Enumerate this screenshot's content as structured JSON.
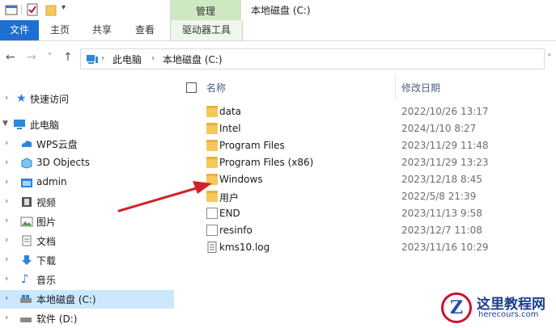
{
  "titlebar": {
    "manage_label": "管理",
    "title": "本地磁盘 (C:)"
  },
  "ribbon": {
    "tabs": [
      "文件",
      "主页",
      "共享",
      "查看",
      "驱动器工具"
    ]
  },
  "nav": {
    "path": [
      "此电脑",
      "本地磁盘 (C:)"
    ]
  },
  "sidebar": {
    "items": [
      {
        "label": "快速访问",
        "icon": "star-icon"
      },
      {
        "label": "此电脑",
        "icon": "computer-icon"
      },
      {
        "label": "WPS云盘",
        "icon": "cloud-icon"
      },
      {
        "label": "3D Objects",
        "icon": "cube-icon"
      },
      {
        "label": "admin",
        "icon": "folder-icon"
      },
      {
        "label": "视频",
        "icon": "video-icon"
      },
      {
        "label": "图片",
        "icon": "picture-icon"
      },
      {
        "label": "文档",
        "icon": "document-icon"
      },
      {
        "label": "下载",
        "icon": "download-icon"
      },
      {
        "label": "音乐",
        "icon": "music-icon"
      },
      {
        "label": "本地磁盘 (C:)",
        "icon": "drive-icon"
      },
      {
        "label": "软件 (D:)",
        "icon": "drive-icon"
      }
    ]
  },
  "filelist": {
    "columns": {
      "name": "名称",
      "date": "修改日期"
    },
    "rows": [
      {
        "name": "data",
        "date": "2022/10/26 13:17",
        "kind": "folder"
      },
      {
        "name": "Intel",
        "date": "2024/1/10 8:27",
        "kind": "folder"
      },
      {
        "name": "Program Files",
        "date": "2023/11/29 11:48",
        "kind": "folder"
      },
      {
        "name": "Program Files (x86)",
        "date": "2023/11/29 13:23",
        "kind": "folder"
      },
      {
        "name": "Windows",
        "date": "2023/12/18 8:45",
        "kind": "folder"
      },
      {
        "name": "用户",
        "date": "2022/5/8 21:39",
        "kind": "folder"
      },
      {
        "name": "END",
        "date": "2023/11/13 9:58",
        "kind": "file"
      },
      {
        "name": "resinfo",
        "date": "2023/12/7 11:08",
        "kind": "file"
      },
      {
        "name": "kms10.log",
        "date": "2023/11/16 10:29",
        "kind": "file"
      }
    ]
  },
  "watermark": {
    "logo_letter": "Z",
    "title": "这里教程网",
    "url": "herecours.com"
  },
  "colors": {
    "accent": "#1f6fd1",
    "manage_tab": "#cfe8c4",
    "selection": "#cce8ff",
    "arrow": "#d2232a"
  }
}
